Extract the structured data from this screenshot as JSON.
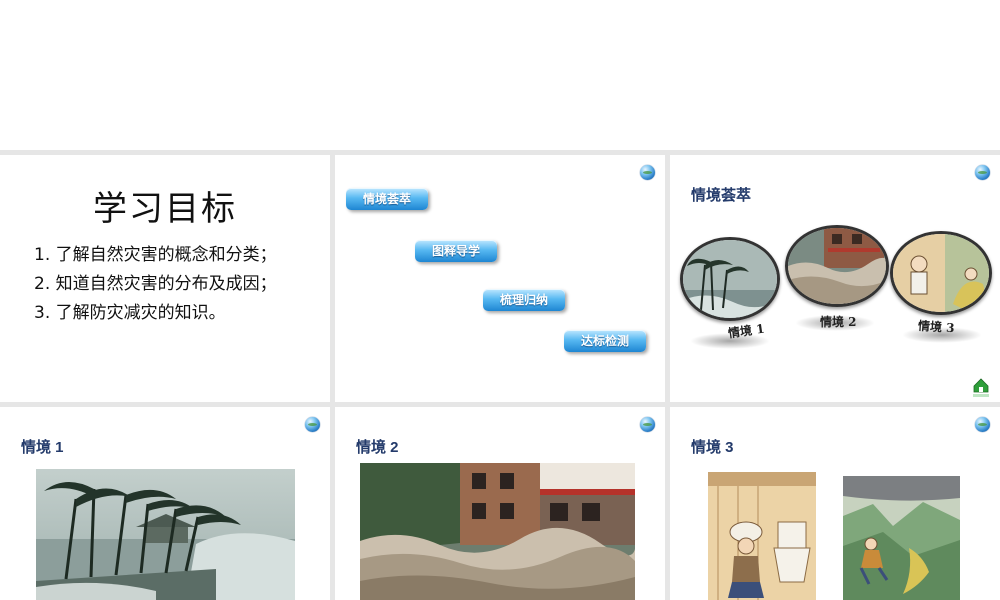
{
  "slide1": {
    "title": "学习目标",
    "goals": [
      "1. 了解自然灾害的概念和分类；",
      "2. 知道自然灾害的分布及成因；",
      "3. 了解防灾减灾的知识。"
    ]
  },
  "slide2": {
    "buttons": [
      "情境荟萃",
      "图释导学",
      "梳理归纳",
      "达标检测"
    ]
  },
  "slide3": {
    "heading": "情境荟萃",
    "labels": [
      "情境 1",
      "情境 2",
      "情境 3"
    ],
    "home_label": "回首页"
  },
  "slide4": {
    "heading": "情境 1"
  },
  "slide5": {
    "heading": "情境 2"
  },
  "slide6": {
    "heading": "情境 3"
  },
  "icons": {
    "globe": "globe-icon",
    "home": "home-icon"
  },
  "colors": {
    "heading": "#243b6b",
    "button": "#1e86d2",
    "home": "#2e9e3a"
  }
}
